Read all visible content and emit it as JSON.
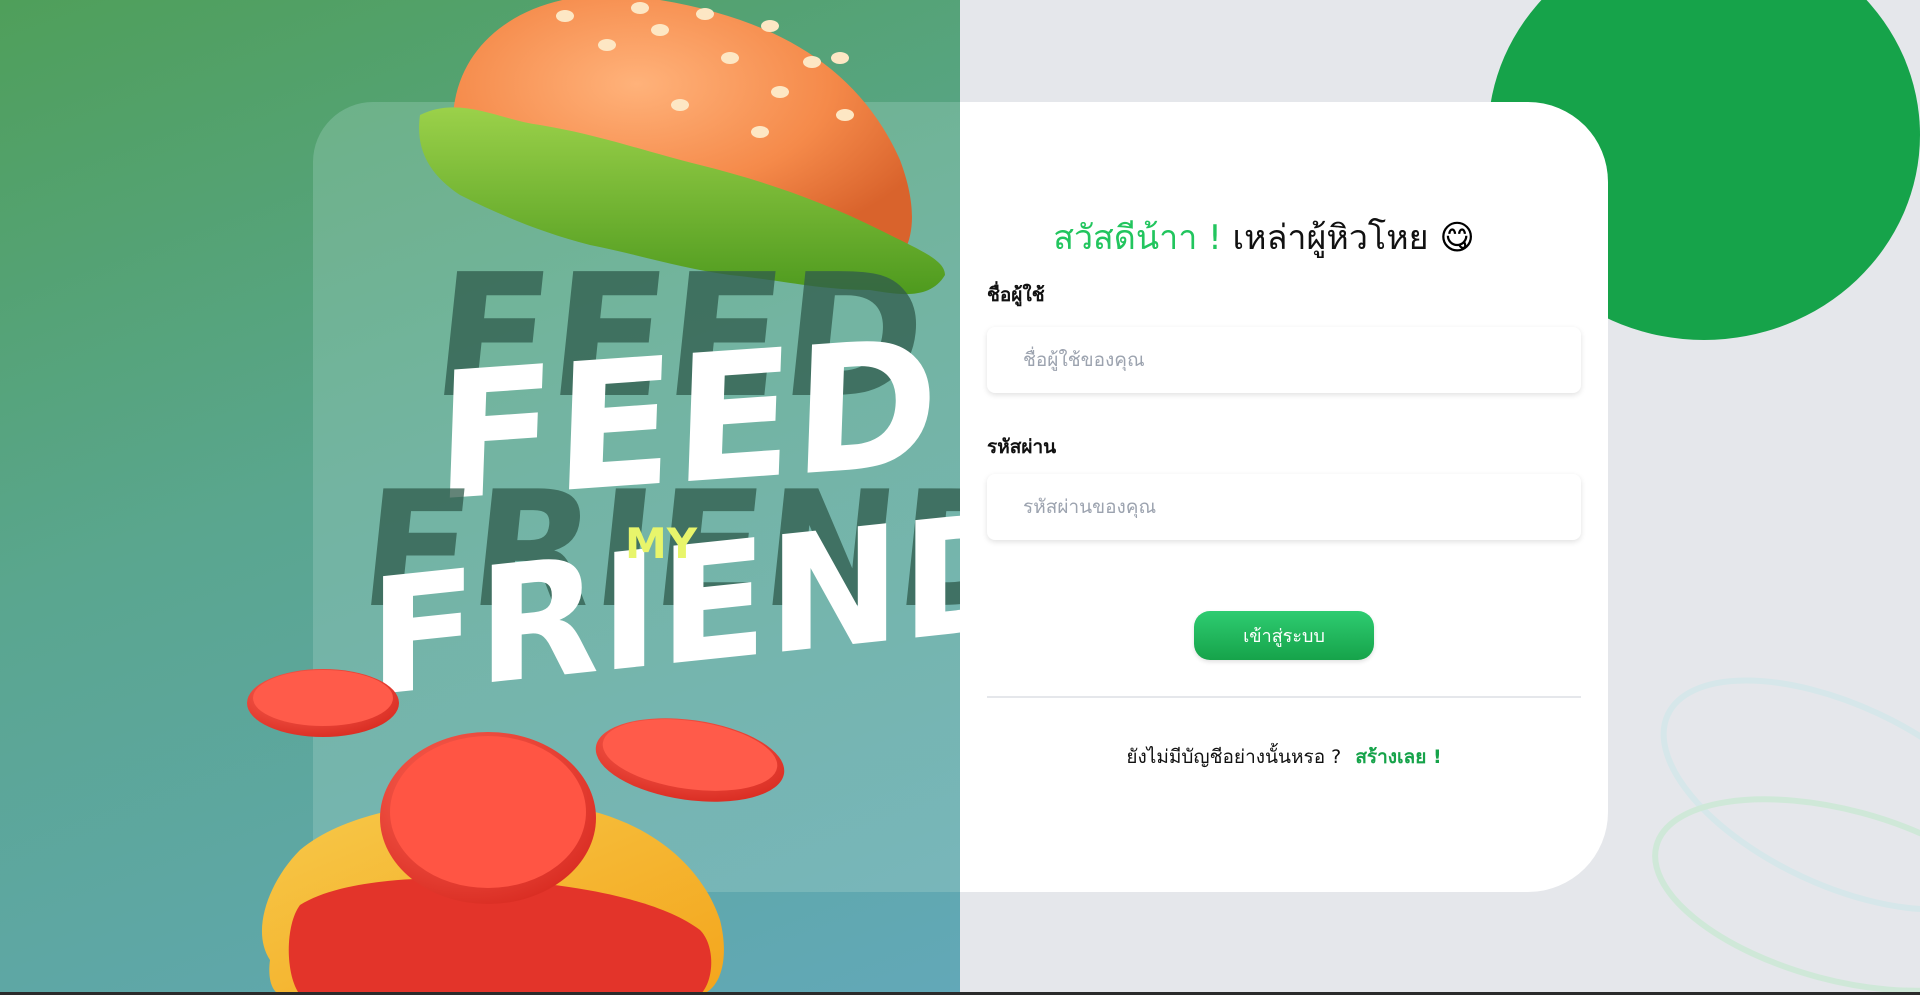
{
  "hero": {
    "title_line1": "FEED",
    "title_middle": "MY",
    "title_line2": "FRIEND"
  },
  "login": {
    "greeting_highlight": "สวัสดีน้าา !",
    "greeting_rest": "เหล่าผู้หิวโหย",
    "greeting_emoji": "😋",
    "username_label": "ชื่อผู้ใช้",
    "username_placeholder": "ชื่อผู้ใช้ของคุณ",
    "password_label": "รหัสผ่าน",
    "password_placeholder": "รหัสผ่านของคุณ",
    "submit_label": "เข้าสู่ระบบ",
    "no_account_text": "ยังไม่มีบัญชีอย่างนั้นหรอ ?",
    "signup_link": "สร้างเลย !"
  },
  "colors": {
    "accent_green": "#16a34a",
    "greeting_green": "#22c55e",
    "background_gray": "#e5e7eb"
  }
}
